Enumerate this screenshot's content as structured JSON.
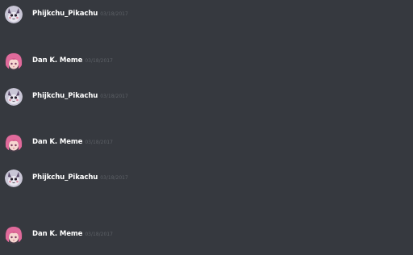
{
  "theme": {
    "background": "#36393f",
    "username_color": "#ffffff",
    "timestamp_color": "#5d6167"
  },
  "messages": [
    {
      "author": "Phijkchu_Pikachu",
      "timestamp": "03/18/2017",
      "avatar": "pikachu-avatar-icon"
    },
    {
      "author": "Dan K. Meme",
      "timestamp": "03/18/2017",
      "avatar": "pink-hair-avatar-icon"
    },
    {
      "author": "Phijkchu_Pikachu",
      "timestamp": "03/18/2017",
      "avatar": "pikachu-avatar-icon"
    },
    {
      "author": "Dan K. Meme",
      "timestamp": "03/18/2017",
      "avatar": "pink-hair-avatar-icon"
    },
    {
      "author": "Phijkchu_Pikachu",
      "timestamp": "03/18/2017",
      "avatar": "pikachu-avatar-icon"
    },
    {
      "author": "Dan K. Meme",
      "timestamp": "03/18/2017",
      "avatar": "pink-hair-avatar-icon"
    }
  ]
}
